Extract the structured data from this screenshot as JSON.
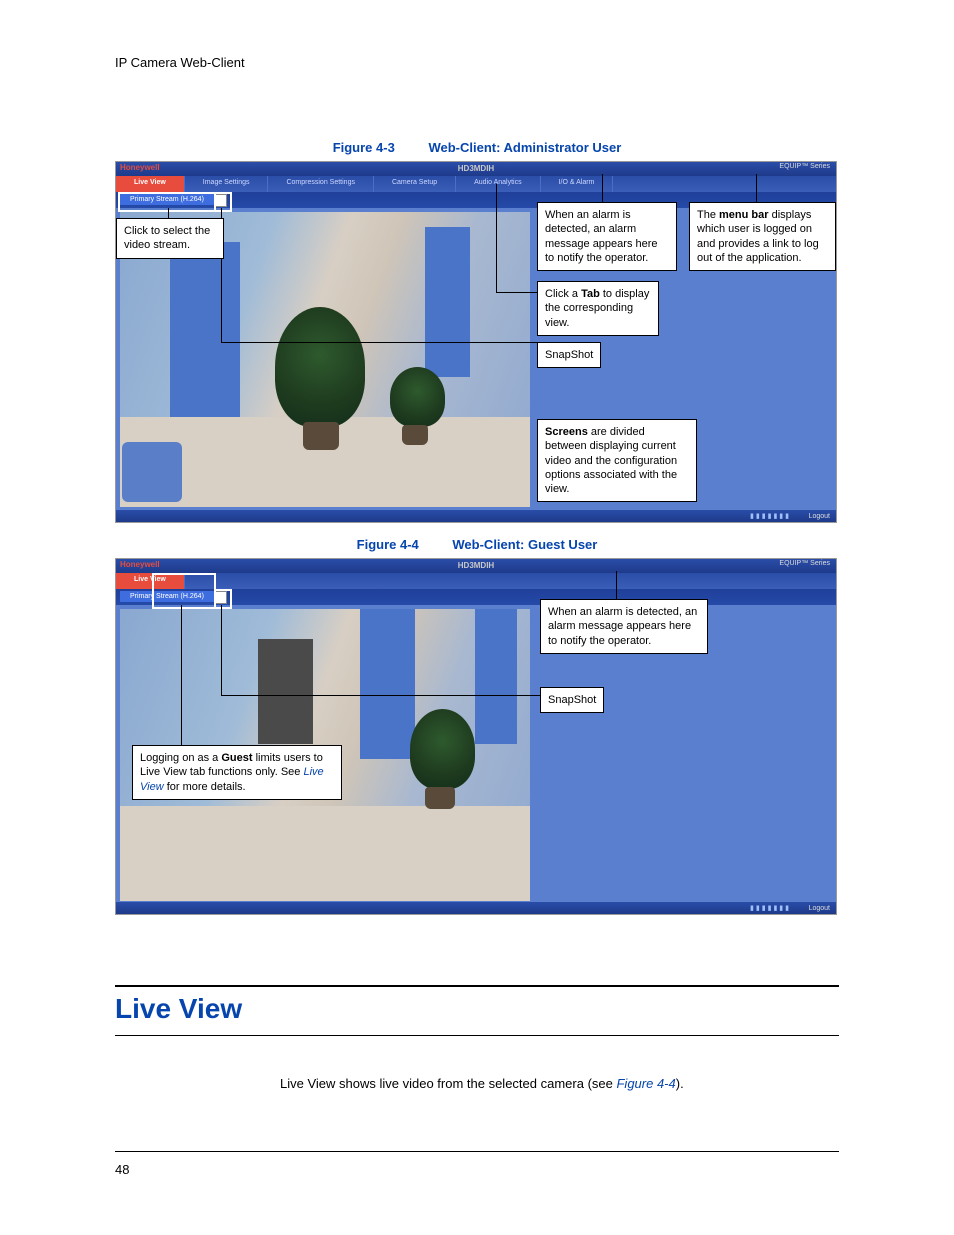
{
  "header": "IP Camera Web-Client",
  "figure43": {
    "number": "Figure 4-3",
    "title": "Web-Client: Administrator User",
    "brand": "Honeywell",
    "model": "HD3MDIH",
    "series": "EQUIP™ Series",
    "tabs": [
      "Live View",
      "Image Settings",
      "Compression Settings",
      "Camera Setup",
      "Audio Analytics",
      "I/O & Alarm"
    ],
    "subtab": "Primary Stream (H.264)",
    "logout": "Logout",
    "callouts": {
      "select_stream": "Click to select the video stream.",
      "alarm": "When an alarm is detected, an alarm message appears here to notify the operator.",
      "menubar_pre": "The ",
      "menubar_bold": "menu bar",
      "menubar_post": " displays which user is logged on and provides a link to log out of the application.",
      "tab_pre": "Click a ",
      "tab_bold": "Tab",
      "tab_post": " to display the corresponding view.",
      "snapshot": "SnapShot",
      "screens_bold": "Screens",
      "screens_post": " are divided between displaying current video and the configuration options associated with the view."
    }
  },
  "figure44": {
    "number": "Figure 4-4",
    "title": "Web-Client: Guest User",
    "brand": "Honeywell",
    "model": "HD3MDIH",
    "series": "EQUIP™ Series",
    "tabs": [
      "Live View"
    ],
    "subtab": "Primary Stream (H.264)",
    "logout": "Logout",
    "callouts": {
      "alarm": "When an alarm is detected, an alarm message appears here to notify the operator.",
      "snapshot": "SnapShot",
      "guest_pre": "Logging on as a ",
      "guest_bold": "Guest",
      "guest_mid": " limits users to Live View tab functions only. See ",
      "guest_link": "Live View",
      "guest_post": " for more details."
    }
  },
  "section": {
    "title": "Live View",
    "para_pre": "Live View shows live video from the selected camera (see ",
    "para_link": "Figure 4-4",
    "para_post": ")."
  },
  "pagenum": "48"
}
